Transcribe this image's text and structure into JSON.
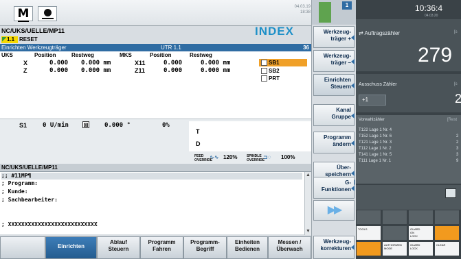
{
  "topbar": {
    "clock_small_date": "04.03.19",
    "clock_small_time": "18:38"
  },
  "channel": {
    "path": "NC/UKS/UELLE/MP11",
    "logo": "INDEX",
    "reset_number": "1.1",
    "reset_label": "RESET"
  },
  "panel": {
    "title": "Einrichten Werkzeugträger",
    "tool_carrier": "UTR 1.1",
    "count": "36"
  },
  "axes": {
    "headers": [
      "UKS",
      "Position",
      "Restweg",
      "MKS",
      "Position",
      "Restweg"
    ],
    "rows": [
      {
        "axis": "X",
        "pos": "0.000",
        "rest": "0.000 mm",
        "mks": "X11",
        "mpos": "0.000",
        "mrest": "0.000 mm"
      },
      {
        "axis": "Z",
        "pos": "0.000",
        "rest": "0.000 mm",
        "mks": "Z11",
        "mpos": "0.000",
        "mrest": "0.000 mm"
      }
    ],
    "options": [
      {
        "label": "SB1",
        "selected": true
      },
      {
        "label": "SB2",
        "selected": false
      },
      {
        "label": "PRT",
        "selected": false
      }
    ]
  },
  "spindle": {
    "name": "S1",
    "speed": "0 U/min",
    "angle": "0.000 °",
    "override": "0%",
    "tool_t": "T",
    "tool_d": "D",
    "feed_override": "120%",
    "spindle_override": "100%"
  },
  "program": {
    "header": "NC/UKS/UELLE/MP11",
    "lines": [
      ";; #11MP¶",
      "; Programm:",
      "; Kunde:",
      "; Sachbearbeiter:",
      "",
      "; XXXXXXXXXXXXXXXXXXXXXXXXXXX"
    ]
  },
  "hsk": [
    {
      "label": "",
      "active": false
    },
    {
      "label": "Einrichten",
      "active": true
    },
    {
      "label": "Ablauf\nSteuern",
      "active": false
    },
    {
      "label": "Programm\nFahren",
      "active": false
    },
    {
      "label": "Programm-\nBegriff",
      "active": false
    },
    {
      "label": "Einheiten\nBedienen",
      "active": false
    },
    {
      "label": "Messen /\nÜberwach",
      "active": false
    }
  ],
  "vsk": {
    "channel_num": "1",
    "buttons": [
      "Werkzeug-\nträger +",
      "Werkzeug-\nträger –",
      "Einrichten\nSteuern",
      "Kanal\nGruppe",
      "Programm\nändern",
      "Über-\nspeichern",
      "G-\nFunktionen"
    ],
    "bottom": "Werkzeug-\nkorrekturen"
  },
  "dark": {
    "clock": "10:36:4",
    "date": "04.03.20",
    "auftrag_label": "Auftragszähler",
    "auftrag_unit": "[s",
    "auftrag_value": "279",
    "ausschuss_label": "Ausschuss Zähler",
    "ausschuss_unit": "[s",
    "ausschuss_button": "+1",
    "ausschuss_value": "2",
    "vorwahl_label": "Vorwahlzähler",
    "vorwahl_unit": "[Rest",
    "vorwahl_rows": [
      {
        "name": "T122 Lage 1 Nr. 4",
        "value": ""
      },
      {
        "name": "T152 Lage 1 Nr. 6",
        "value": "2"
      },
      {
        "name": "T121 Lage 1 Nr. 3",
        "value": "2"
      },
      {
        "name": "T112 Lage 1 Nr. 2",
        "value": "3"
      },
      {
        "name": "T141 Lage 1 Nr. 5",
        "value": "3"
      },
      {
        "name": "T111 Lage 1 Nr. 1",
        "value": "9"
      }
    ],
    "tiles": {
      "tools": "TOOLS",
      "guard": "GUARD\nON\nLOCK",
      "auth": "AUTHORIZED\nMODE",
      "guard_lock": "GUARD\nLOCK",
      "clear": "CLEAR"
    }
  }
}
